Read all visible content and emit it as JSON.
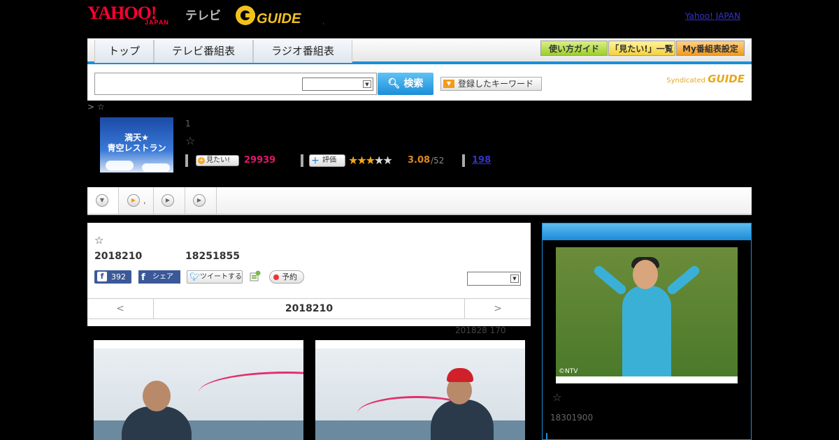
{
  "header": {
    "yahoo": "YAHOO!",
    "japan": "JAPAN",
    "tv": "テレビ",
    "gguide": "GUIDE",
    "right_link": "Yahoo! JAPAN",
    "dot": ","
  },
  "nav": {
    "tabs": [
      "トップ",
      "テレビ番組表",
      "ラジオ番組表"
    ],
    "right_buttons": [
      "使い方ガイド",
      "「見たい!」一覧",
      "My番組表設定"
    ]
  },
  "search": {
    "button_label": "検索",
    "keyword_button": "登録したキーワード",
    "syndicated": "Syndicated"
  },
  "breadcrumb": "> ☆",
  "program": {
    "thumb_text": "満天★\n青空レストラン",
    "number": "1",
    "star": "☆",
    "mitai_label": "見たい!",
    "mitai_count": "29939",
    "hyouka_label": "評価",
    "rating": "3.08",
    "rating_count": "/52",
    "review_count": "198"
  },
  "tabstrip": {
    "tab2_label": ","
  },
  "main": {
    "star": "☆",
    "date": "2018210",
    "time": "18251855",
    "fb_count": "392",
    "fb_share": "シェア",
    "tweet": "ツイートする",
    "yoyaku": "予約",
    "pager_prev": "<",
    "pager_mid": "2018210",
    "pager_next": ">"
  },
  "update_info": "201828  170",
  "side": {
    "star": "☆",
    "time": "18301900",
    "credit": "©NTV"
  },
  "colors": {
    "accent_blue": "#1a8fd8",
    "mitai_pink": "#e0166d",
    "rating_orange": "#e08a1e",
    "link_blue": "#3333cc"
  }
}
